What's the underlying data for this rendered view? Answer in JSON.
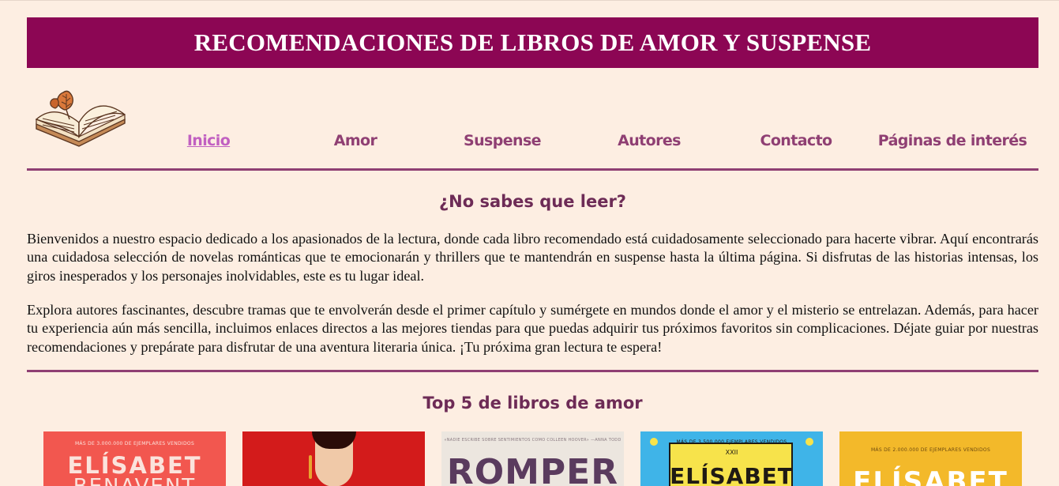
{
  "header": {
    "title": "RECOMENDACIONES DE LIBROS DE AMOR Y SUSPENSE"
  },
  "logo": {
    "icon": "open-book-with-leaf-icon"
  },
  "nav": {
    "items": [
      {
        "label": "Inicio",
        "active": true
      },
      {
        "label": "Amor",
        "active": false
      },
      {
        "label": "Suspense",
        "active": false
      },
      {
        "label": "Autores",
        "active": false
      },
      {
        "label": "Contacto",
        "active": false
      },
      {
        "label": "Páginas de interés",
        "active": false
      }
    ]
  },
  "intro": {
    "heading": "¿No sabes que leer?",
    "paragraph1": "Bienvenidos a nuestro espacio dedicado a los apasionados de la lectura, donde cada libro recomendado está cuidadosamente seleccionado para hacerte vibrar. Aquí encontrarás una cuidadosa selección de novelas románticas que te emocionarán y thrillers que te mantendrán en suspense hasta la última página. Si disfrutas de las historias intensas, los giros inesperados y los personajes inolvidables, este es tu lugar ideal.",
    "paragraph2": "Explora autores fascinantes, descubre tramas que te envolverán desde el primer capítulo y sumérgete en mundos donde el amor y el misterio se entrelazan. Además, para hacer tu experiencia aún más sencilla, incluimos enlaces directos a las mejores tiendas para que puedas adquirir tus próximos favoritos sin complicaciones. Déjate guiar por nuestras recomendaciones y prepárate para disfrutar de una aventura literaria única. ¡Tu próxima gran lectura te espera!"
  },
  "top_love": {
    "heading": "Top 5 de libros de amor",
    "books": [
      {
        "tag": "MÁS DE 3.000.000 DE EJEMPLARES VENDIDOS",
        "title": "ELÍSABET",
        "subtitle": "BENAVENT",
        "bg": "#f2574f",
        "fg": "#fbe3dc"
      },
      {
        "tag": "",
        "title": "",
        "subtitle": "",
        "bg": "#d31b1b",
        "fg": "#ffffff"
      },
      {
        "tag": "«NADIE ESCRIBE SOBRE SENTIMIENTOS COMO COLLEEN HOOVER» —ANNA TODD",
        "title": "ROMPER",
        "subtitle": "",
        "bg": "#ece6df",
        "fg": "#5a3b5e"
      },
      {
        "tag": "MÁS DE 3.500.000 EJEMPLARES VENDIDOS",
        "title": "ELÍSABET",
        "subtitle": "XXII",
        "bg": "#3fb4e8",
        "fg": "#1f1a14"
      },
      {
        "tag": "MÁS DE 2.000.000 DE EJEMPLARES VENDIDOS",
        "title": "ELÍSABET",
        "subtitle": "",
        "bg": "#f3b92a",
        "fg": "#ffffff"
      }
    ]
  }
}
